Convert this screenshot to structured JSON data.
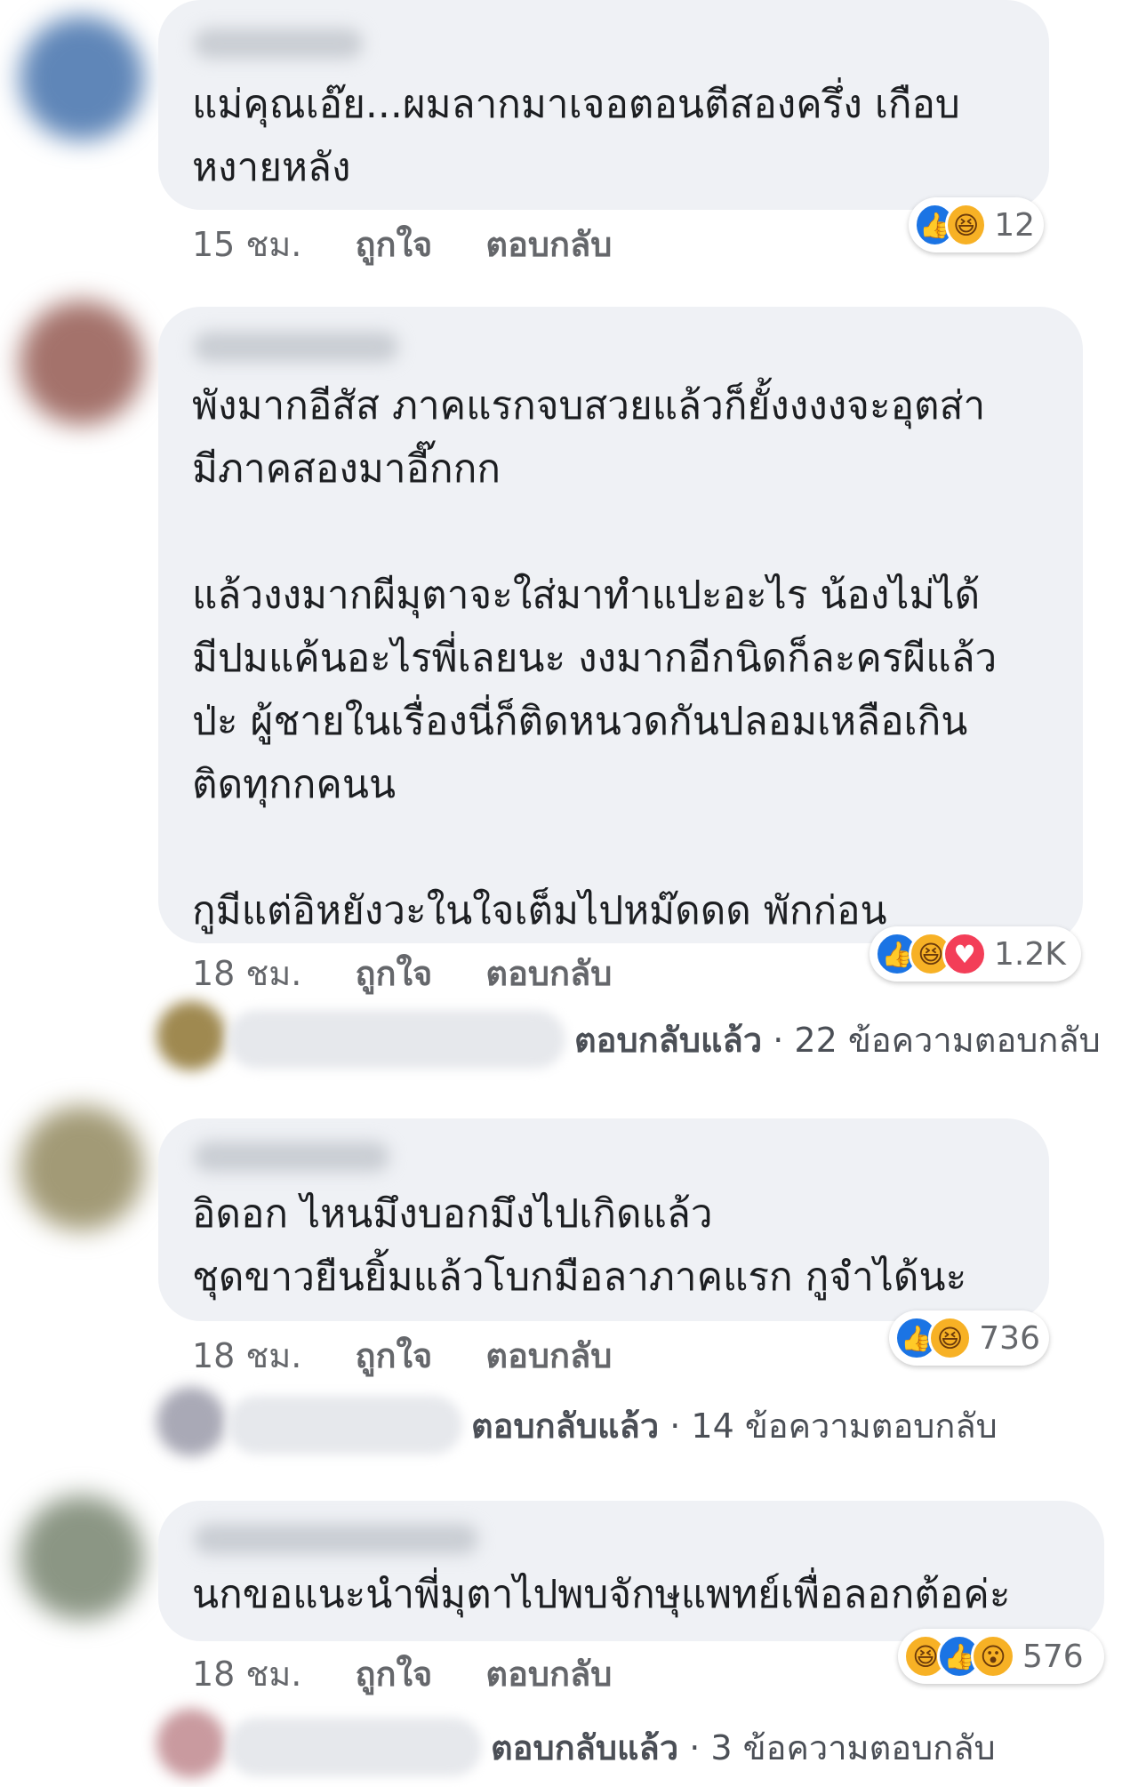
{
  "comments": [
    {
      "text": "แม่คุณเอ๊ย...ผมลากมาเจอตอนตีสองครึ่ง เกือบ\nหงายหลัง",
      "time": "15 ชม.",
      "like": "ถูกใจ",
      "reply": "ตอบกลับ",
      "reactions": [
        "like-icon",
        "haha-icon"
      ],
      "count": "12"
    },
    {
      "text": "พังมากอีสัส ภาคแรกจบสวยแล้วก็ยั้งงงงจะอุตส่า\nมีภาคสองมาอี๊กกก\n\nแล้วงงมากผีมุตาจะใส่มาทำแปะอะไร น้องไม่ได้\nมีปมแค้นอะไรพี่เลยนะ งงมากอีกนิดก็ละครผีแล้ว\nป่ะ ผู้ชายในเรื่องนี่ก็ติดหนวดกันปลอมเหลือเกิน\nติดทุกกคนน\n\nกูมีแต่อิหยังวะในใจเต็มไปหม๊ดดด พักก่อน",
      "time": "18 ชม.",
      "like": "ถูกใจ",
      "reply": "ตอบกลับ",
      "reactions": [
        "like-icon",
        "haha-icon",
        "love-icon"
      ],
      "count": "1.2K",
      "replied": "ตอบกลับแล้ว",
      "replies": " · 22 ข้อความตอบกลับ"
    },
    {
      "text": "อิดอก ไหนมึงบอกมึงไปเกิดแล้ว\nชุดขาวยืนยิ้มแล้วโบกมือลาภาคแรก กูจำได้นะ",
      "time": "18 ชม.",
      "like": "ถูกใจ",
      "reply": "ตอบกลับ",
      "reactions": [
        "like-icon",
        "haha-icon"
      ],
      "count": "736",
      "replied": "ตอบกลับแล้ว",
      "replies": " · 14 ข้อความตอบกลับ"
    },
    {
      "text": "นกขอแนะนำพี่มุตาไปพบจักษุแพทย์เพื่อลอกต้อค่ะ",
      "time": "18 ชม.",
      "like": "ถูกใจ",
      "reply": "ตอบกลับ",
      "reactions": [
        "haha-icon",
        "like-icon",
        "wow-icon"
      ],
      "count": "576",
      "replied": "ตอบกลับแล้ว",
      "replies": " · 3 ข้อความตอบกลับ"
    }
  ],
  "colors": {
    "bubble": "#eff1f5",
    "like": "#1b74e4",
    "haha": "#f7b125",
    "love": "#f33e58",
    "meta": "#65676b"
  }
}
